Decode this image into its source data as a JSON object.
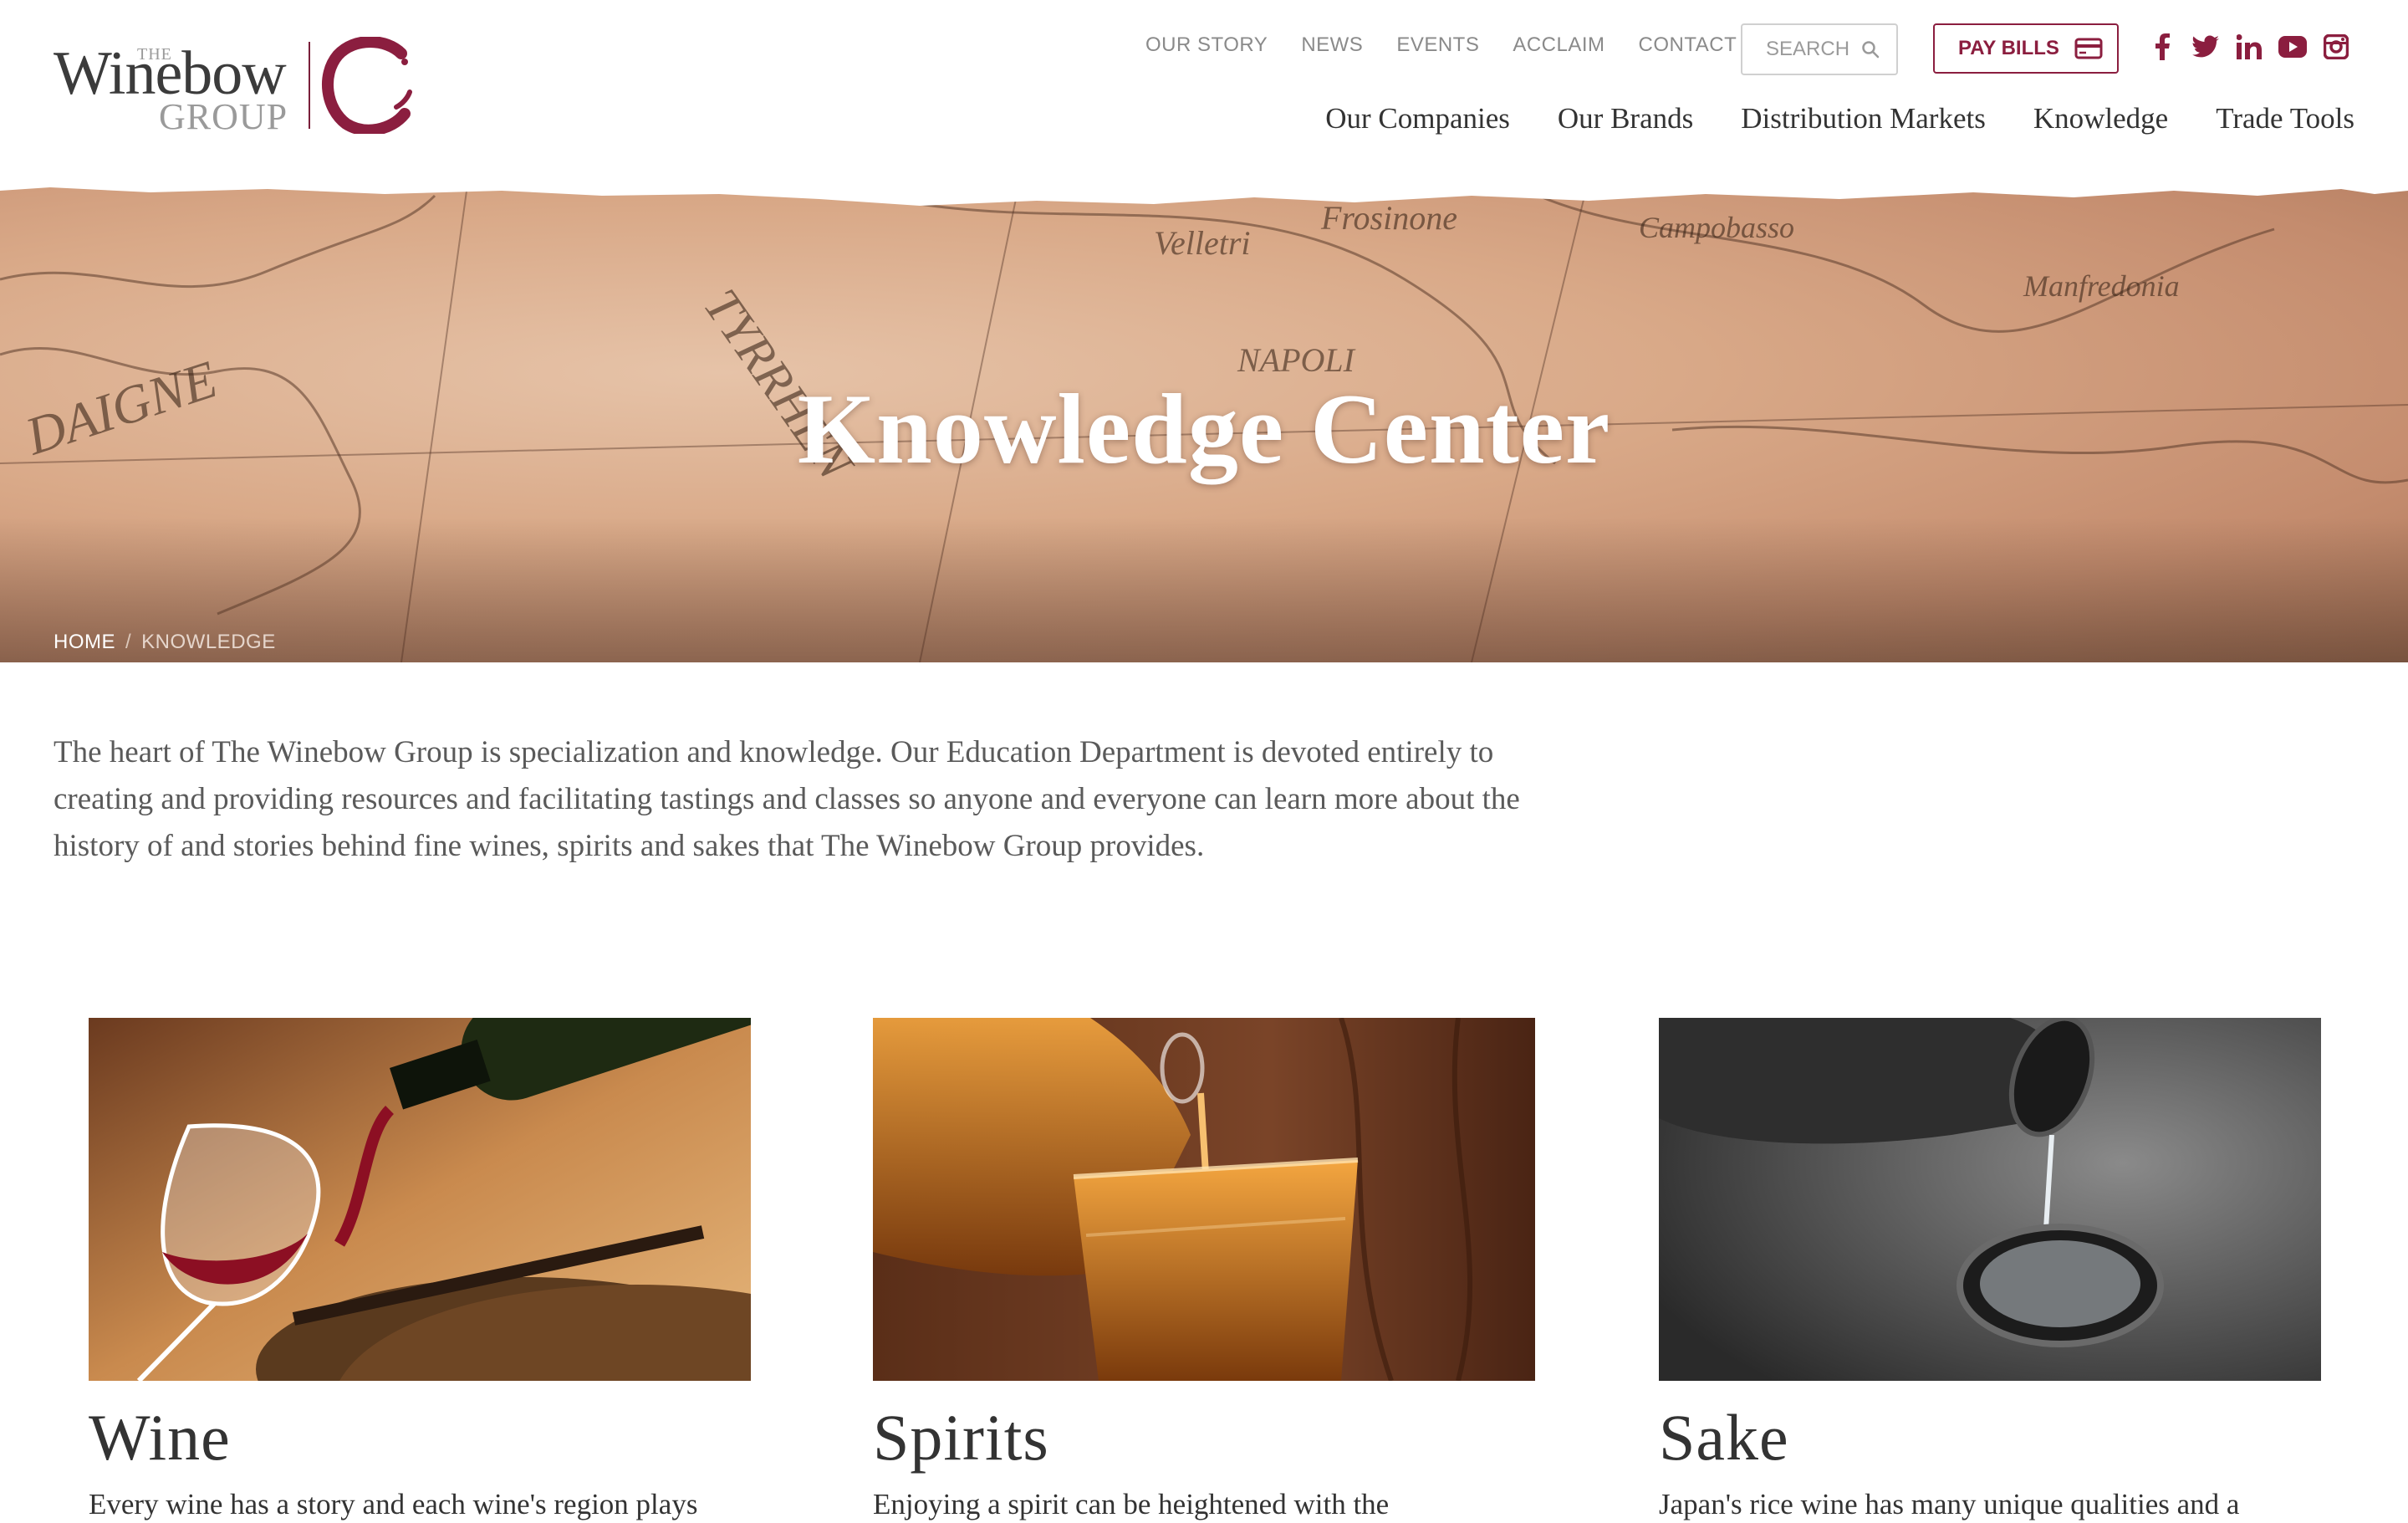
{
  "logo": {
    "the": "THE",
    "name": "Winebow",
    "sub": "GROUP"
  },
  "top_nav": [
    "OUR STORY",
    "NEWS",
    "EVENTS",
    "ACCLAIM",
    "CONTACT"
  ],
  "search": {
    "label": "SEARCH"
  },
  "pay_bills": {
    "label": "PAY BILLS"
  },
  "social": [
    "facebook-icon",
    "twitter-icon",
    "linkedin-icon",
    "youtube-icon",
    "instagram-icon"
  ],
  "main_nav": [
    "Our Companies",
    "Our Brands",
    "Distribution Markets",
    "Knowledge",
    "Trade Tools"
  ],
  "hero": {
    "title": "Knowledge Center"
  },
  "breadcrumb": {
    "home": "HOME",
    "separator": "/",
    "current": "KNOWLEDGE"
  },
  "intro": "The heart of The Winebow Group is specialization and knowledge. Our Education Department is devoted entirely to creating and providing resources and facilitating tastings and classes so anyone and everyone can learn more about the history of and stories behind fine wines, spirits and sakes that The Winebow Group provides.",
  "cards": [
    {
      "title": "Wine",
      "desc": "Every wine has a story and each wine's region plays"
    },
    {
      "title": "Spirits",
      "desc": "Enjoying a spirit can be heightened with the"
    },
    {
      "title": "Sake",
      "desc": "Japan's rice wine has many unique qualities and a"
    }
  ],
  "colors": {
    "brand": "#8b1e3f",
    "text": "#333333",
    "muted": "#8a8a8a"
  }
}
